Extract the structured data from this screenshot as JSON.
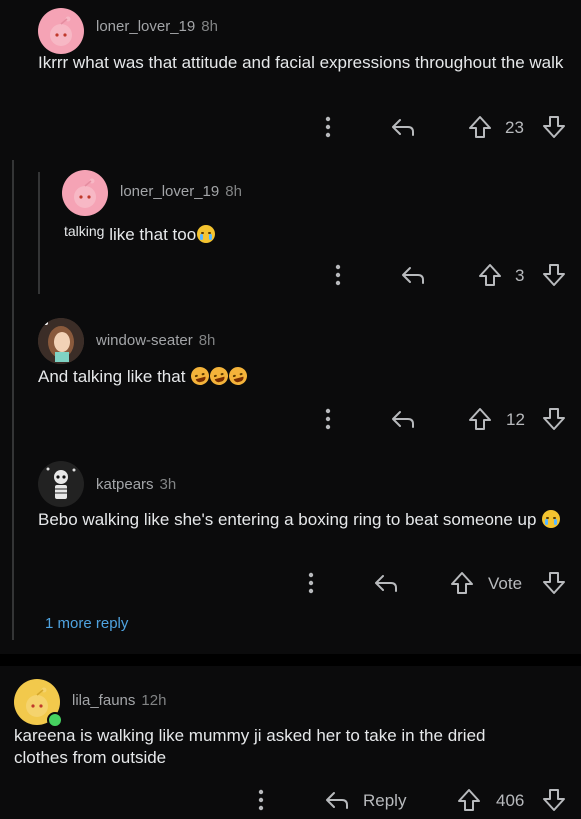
{
  "comments": [
    {
      "user": "loner_lover_19",
      "time": "8h",
      "text": "Ikrrr what was that attitude and facial expressions throughout the walk",
      "votes": "23"
    },
    {
      "user": "loner_lover_19",
      "time": "8h",
      "text_prefix": "talking",
      "text": "like that too",
      "votes": "3"
    },
    {
      "user": "window-seater",
      "time": "8h",
      "text": "And talking like that",
      "votes": "12"
    },
    {
      "user": "katpears",
      "time": "3h",
      "text": "Bebo walking like she's entering a boxing ring to beat someone up",
      "votes": "Vote"
    },
    {
      "user": "lila_fauns",
      "time": "12h",
      "text": "kareena is walking like mummy ji asked her to take in the dried clothes from outside",
      "votes": "406",
      "reply_label": "Reply"
    }
  ],
  "more_replies": "1 more reply",
  "colors": {
    "background": "#0b0b0c",
    "link": "#4fa3e0",
    "online": "#46d160",
    "avatar_pink": "#f5a3b5",
    "avatar_yellow": "#f2c94c"
  }
}
